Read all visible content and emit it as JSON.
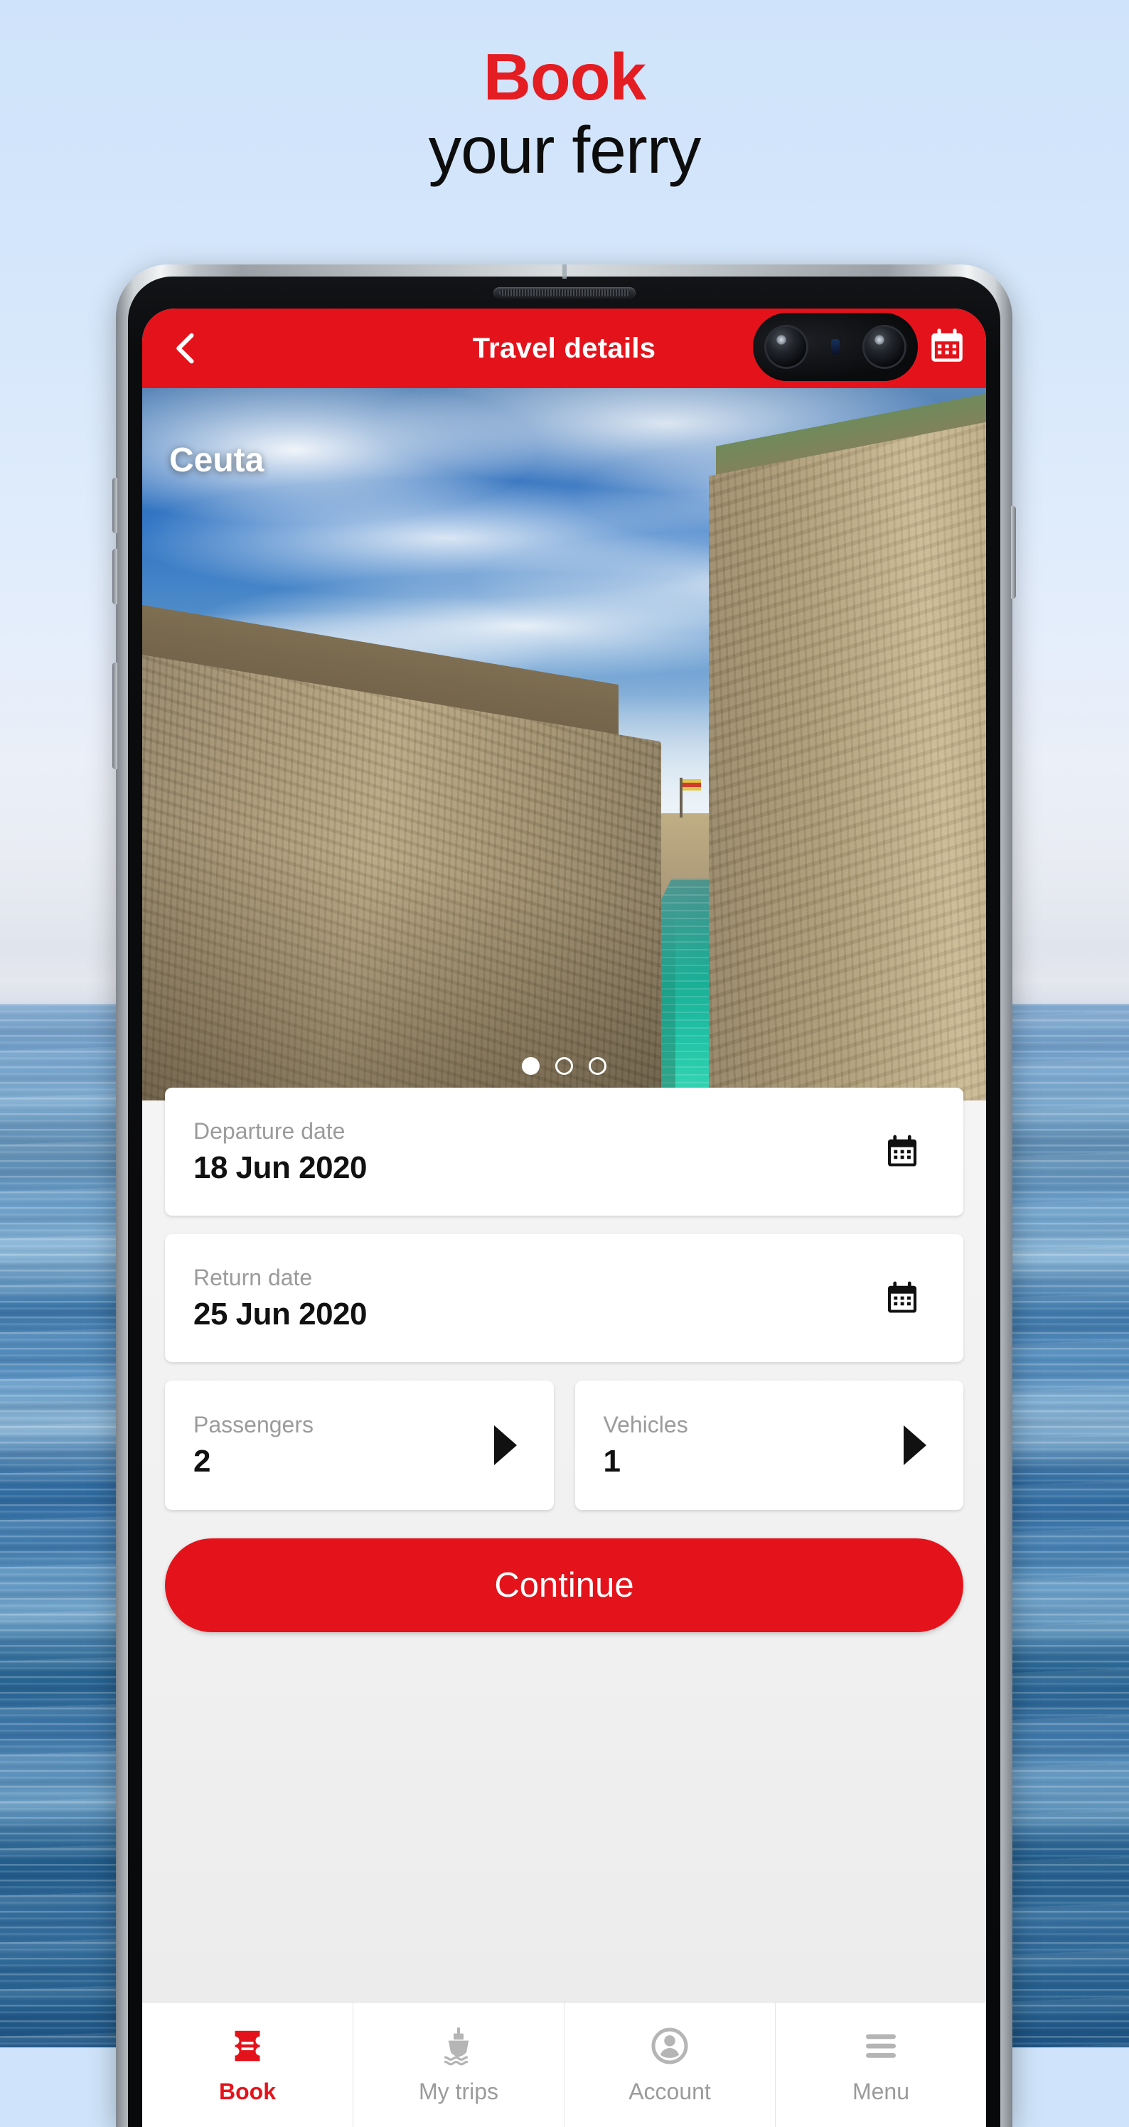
{
  "promo": {
    "line1": "Book",
    "line2": "your ferry",
    "accent_color": "#e41d22",
    "text_color": "#0d0d0d"
  },
  "app": {
    "brand_color": "#e4131b",
    "appbar": {
      "back_icon": "chevron-left-icon",
      "title": "Travel details",
      "calendar_icon": "calendar-icon"
    },
    "hero": {
      "city": "Ceuta",
      "carousel": {
        "total": 3,
        "active_index": 0
      }
    },
    "form": {
      "departure": {
        "label": "Departure date",
        "value": "18 Jun 2020",
        "icon": "calendar-icon"
      },
      "return": {
        "label": "Return date",
        "value": "25 Jun 2020",
        "icon": "calendar-icon"
      },
      "passengers": {
        "label": "Passengers",
        "value": "2",
        "icon": "triangle-right-icon"
      },
      "vehicles": {
        "label": "Vehicles",
        "value": "1",
        "icon": "triangle-right-icon"
      },
      "continue_label": "Continue"
    },
    "bottom_nav": {
      "items": [
        {
          "label": "Book",
          "icon": "ticket-icon",
          "active": true
        },
        {
          "label": "My trips",
          "icon": "ferry-icon",
          "active": false
        },
        {
          "label": "Account",
          "icon": "person-icon",
          "active": false
        },
        {
          "label": "Menu",
          "icon": "hamburger-icon",
          "active": false
        }
      ]
    }
  }
}
